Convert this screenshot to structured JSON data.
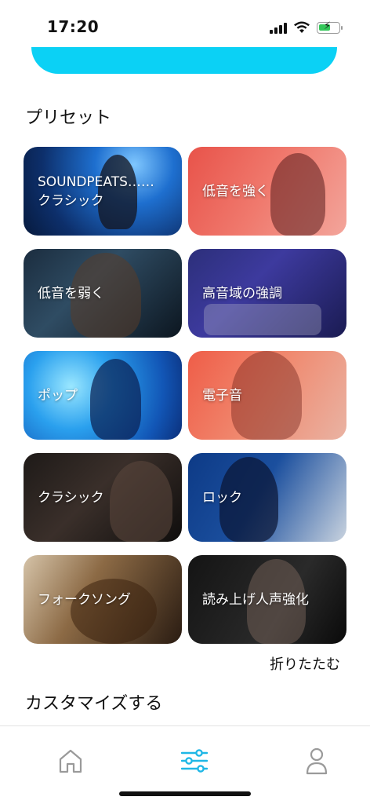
{
  "status_bar": {
    "time": "17:20",
    "battery_level": 0.6,
    "battery_color": "#34c759"
  },
  "accent_color": "#0bd1f5",
  "presets": {
    "title": "プリセット",
    "items": [
      {
        "label": "SOUNDPEATS……\nクラシック",
        "line1": "SOUNDPEATS……",
        "line2": "クラシック"
      },
      {
        "label": "低音を強く"
      },
      {
        "label": "低音を弱く"
      },
      {
        "label": "高音域の強調"
      },
      {
        "label": "ポップ"
      },
      {
        "label": "電子音"
      },
      {
        "label": "クラシック"
      },
      {
        "label": "ロック"
      },
      {
        "label": "フォークソング"
      },
      {
        "label": "読み上げ人声強化"
      }
    ],
    "collapse_label": "折りたたむ"
  },
  "customize": {
    "title": "カスタマイズする"
  },
  "tab_bar": {
    "active_tab": "equalizer",
    "tabs": [
      {
        "icon": "home-icon"
      },
      {
        "icon": "equalizer-icon"
      },
      {
        "icon": "profile-icon"
      }
    ],
    "active_color": "#1fb7e6",
    "inactive_color": "#9a9a9a"
  }
}
